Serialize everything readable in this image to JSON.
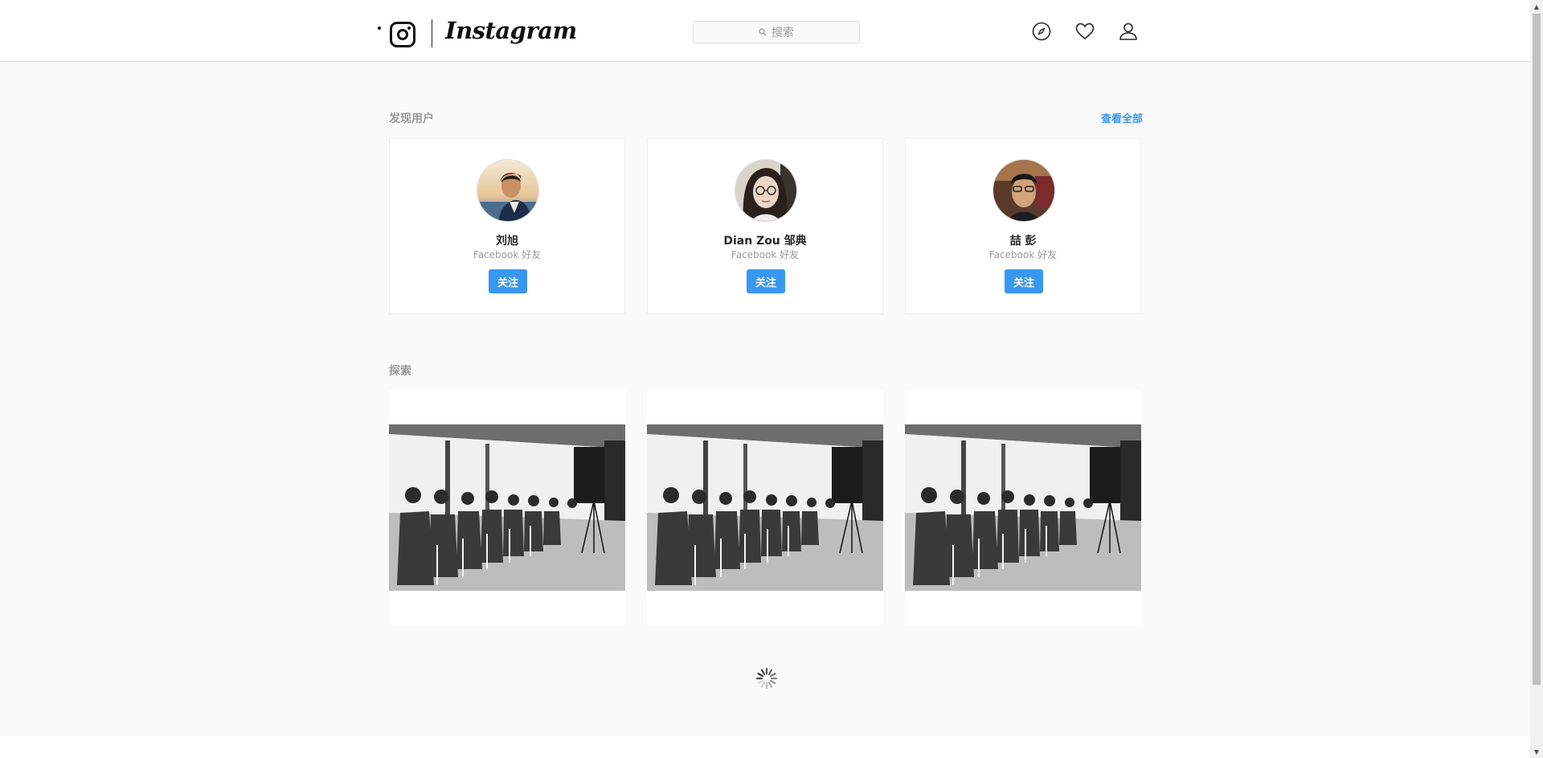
{
  "header": {
    "wordmark": "Instagram",
    "search_placeholder": "搜索"
  },
  "discover": {
    "title": "发现用户",
    "see_all": "查看全部",
    "users": [
      {
        "name": "刘旭",
        "subtitle": "Facebook 好友",
        "follow_label": "关注"
      },
      {
        "name": "Dian Zou 邹典",
        "subtitle": "Facebook 好友",
        "follow_label": "关注"
      },
      {
        "name": "喆 彭",
        "subtitle": "Facebook 好友",
        "follow_label": "关注"
      }
    ]
  },
  "explore": {
    "title": "探索"
  },
  "colors": {
    "accent": "#3897f0",
    "muted_text": "#999999",
    "border": "#dbdbdb"
  }
}
